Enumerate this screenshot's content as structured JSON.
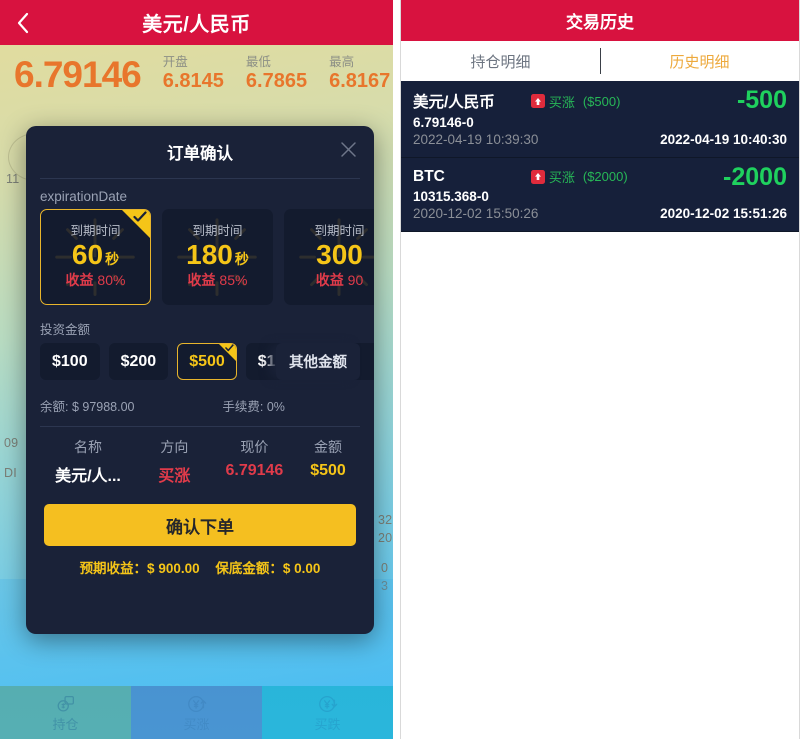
{
  "left": {
    "header": {
      "title": "美元/人民币",
      "back_icon": "chevron-left-icon"
    },
    "quote": {
      "price": "6.79146",
      "stats": [
        {
          "label": "开盘",
          "value": "6.8145"
        },
        {
          "label": "最低",
          "value": "6.7865"
        },
        {
          "label": "最高",
          "value": "6.8167"
        }
      ]
    },
    "background_fragments": {
      "tick_1": "11",
      "tick_2": "09",
      "tick_3": "DI",
      "right_1": "32",
      "right_2": "20",
      "right_3": "0",
      "right_4": "3"
    },
    "bottom_nav": [
      {
        "label": "持仓",
        "icon": "coins-stack-icon"
      },
      {
        "label": "买涨",
        "icon": "yen-up-icon"
      },
      {
        "label": "买跌",
        "icon": "yen-down-icon"
      }
    ],
    "modal": {
      "title": "订单确认",
      "close_icon": "close-icon",
      "expiration_label": "expirationDate",
      "expirations": [
        {
          "top": "到期时间",
          "num": "60",
          "unit": "秒",
          "profit_label": "收益",
          "profit": "80%",
          "selected": true
        },
        {
          "top": "到期时间",
          "num": "180",
          "unit": "秒",
          "profit_label": "收益",
          "profit": "85%",
          "selected": false
        },
        {
          "top": "到期时间",
          "num": "300",
          "unit": "秒",
          "profit_label": "收益",
          "profit": "90",
          "selected": false
        }
      ],
      "amount_label": "投资金额",
      "amounts": [
        {
          "label": "$100",
          "selected": false
        },
        {
          "label": "$200",
          "selected": false
        },
        {
          "label": "$500",
          "selected": true
        },
        {
          "label": "$1000",
          "selected": false
        },
        {
          "label": "$",
          "selected": false
        }
      ],
      "other_amount_label": "其他金额",
      "balance": "余额: $ 97988.00",
      "fee": "手续费: 0%",
      "summary_headers": [
        "名称",
        "方向",
        "现价",
        "金额"
      ],
      "summary_values": {
        "name": "美元/人...",
        "direction": "买涨",
        "price": "6.79146",
        "amount": "$500"
      },
      "confirm_label": "确认下单",
      "expected_profit": "预期收益：$ 900.00",
      "guaranteed_amount": "保底金额：$ 0.00"
    }
  },
  "right": {
    "header": {
      "title": "交易历史"
    },
    "tabs": [
      {
        "label": "持仓明细",
        "active": false
      },
      {
        "label": "历史明细",
        "active": true
      }
    ],
    "history": [
      {
        "symbol": "美元/人民币",
        "direction_icon": "arrow-up-icon",
        "direction": "买涨",
        "cost": "($500)",
        "pnl": "-500",
        "price": "6.79146-",
        "price_delta": "0",
        "open_time": "2022-04-19 10:39:30",
        "close_time": "2022-04-19 10:40:30"
      },
      {
        "symbol": "BTC",
        "direction_icon": "arrow-up-icon",
        "direction": "买涨",
        "cost": "($2000)",
        "pnl": "-2000",
        "price": "10315.368-",
        "price_delta": "0",
        "open_time": "2020-12-02 15:50:26",
        "close_time": "2020-12-02 15:51:26"
      }
    ]
  },
  "colors": {
    "brand_red": "#d8123f",
    "accent_yellow": "#f5c518",
    "profit_green": "#1fd15e",
    "modal_bg": "#1a2238",
    "price_orange": "#e8762c"
  }
}
